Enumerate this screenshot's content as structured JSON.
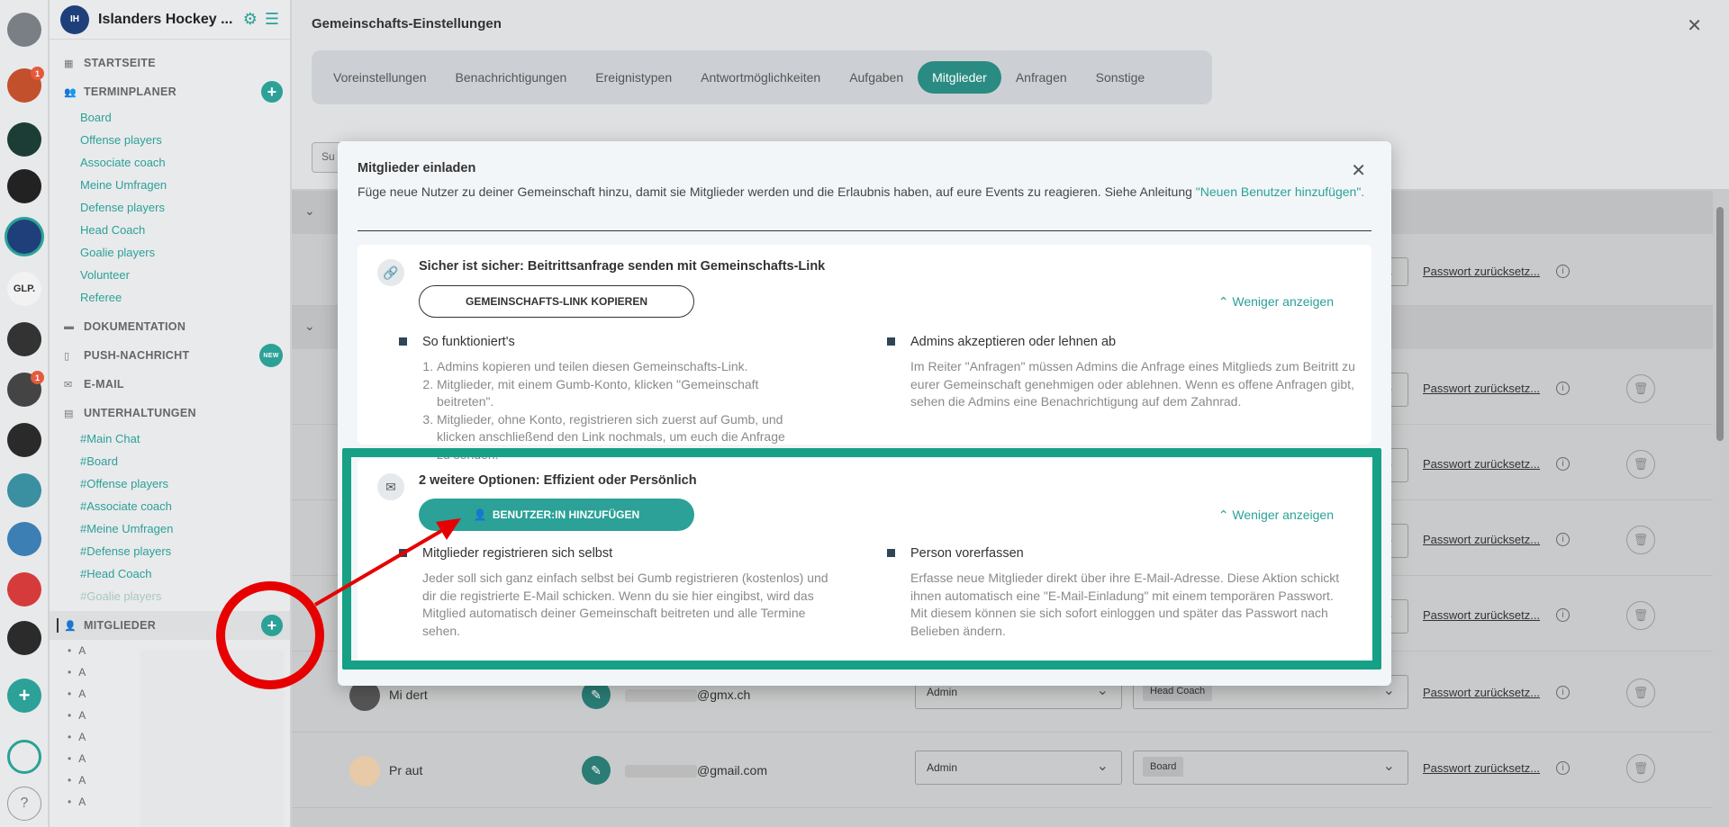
{
  "community": {
    "name": "Islanders Hockey ...",
    "rail": [
      {
        "label": "",
        "color": "#7a7f86",
        "badge": ""
      },
      {
        "label": "",
        "color": "#c2502d",
        "badge": "1"
      },
      {
        "label": "",
        "color": "#1c3d36",
        "badge": ""
      },
      {
        "label": "",
        "color": "#222",
        "badge": ""
      },
      {
        "label": "",
        "color": "#1f3f7a",
        "badge": ""
      },
      {
        "label": "GLP.",
        "color": "#f2f2f2",
        "badge": ""
      },
      {
        "label": "",
        "color": "#333",
        "badge": ""
      },
      {
        "label": "",
        "color": "#444",
        "badge": "1"
      },
      {
        "label": "",
        "color": "#2a2a2a",
        "badge": ""
      },
      {
        "label": "",
        "color": "#3a8fa0",
        "badge": ""
      },
      {
        "label": "",
        "color": "#3b7fb5",
        "badge": ""
      },
      {
        "label": "",
        "color": "#d63b3b",
        "badge": ""
      },
      {
        "label": "",
        "color": "#2b2b2b",
        "badge": ""
      }
    ],
    "add_label": "+",
    "help_label": "?"
  },
  "sidebar": {
    "startseite": "STARTSEITE",
    "terminplaner": "TERMINPLANER",
    "termin_items": [
      "Board",
      "Offense players",
      "Associate coach",
      "Meine Umfragen",
      "Defense players",
      "Head Coach",
      "Goalie players",
      "Volunteer",
      "Referee"
    ],
    "dokumentation": "DOKUMENTATION",
    "push": "PUSH-NACHRICHT",
    "push_badge": "NEW",
    "email": "E-MAIL",
    "unterhaltungen": "UNTERHALTUNGEN",
    "chat_items": [
      "#Main Chat",
      "#Board",
      "#Offense players",
      "#Associate coach",
      "#Meine Umfragen",
      "#Defense players",
      "#Head Coach"
    ],
    "chat_dim": "#Goalie players",
    "mitglieder": "MITGLIEDER",
    "members": [
      "A",
      "A",
      "A",
      "A",
      "A",
      "A",
      "A",
      "A"
    ]
  },
  "main": {
    "title": "Gemeinschafts-Einstellungen",
    "tabs": [
      "Voreinstellungen",
      "Benachrichtigungen",
      "Ereignistypen",
      "Antwortmöglichkeiten",
      "Aufgaben",
      "Mitglieder",
      "Anfragen",
      "Sonstige"
    ],
    "active_tab": "Mitglieder",
    "search_stub": "Su",
    "rows": [
      {
        "name": "Mi      dert",
        "email": "@gmx.ch",
        "role": "Admin",
        "group": "Head Coach",
        "pw": "Passwort zurücksetz..."
      },
      {
        "name": "Pr      aut",
        "email": "@gmail.com",
        "role": "Admin",
        "group": "Board",
        "pw": "Passwort zurücksetz..."
      }
    ],
    "pw_link": "Passwort zurücksetz..."
  },
  "modal": {
    "title": "Mitglieder einladen",
    "desc": "Füge neue Nutzer zu deiner Gemeinschaft hinzu, damit sie Mitglieder werden und die Erlaubnis haben, auf eure Events zu reagieren. Siehe Anleitung ",
    "desc_link": "\"Neuen Benutzer hinzufügen\".",
    "card1": {
      "title": "Sicher ist sicher: Beitrittsanfrage senden mit Gemeinschafts-Link",
      "button": "GEMEINSCHAFTS-LINK KOPIEREN",
      "less": "Weniger anzeigen",
      "left_head": "So funktioniert's",
      "left_steps": [
        "Admins kopieren und teilen diesen Gemeinschafts-Link.",
        "Mitglieder, mit einem Gumb-Konto, klicken \"Gemeinschaft beitreten\".",
        "Mitglieder, ohne Konto, registrieren sich zuerst auf Gumb, und klicken anschließend den Link nochmals, um euch die Anfrage zu senden."
      ],
      "right_head": "Admins akzeptieren oder lehnen ab",
      "right_text": "Im Reiter \"Anfragen\" müssen Admins die Anfrage eines Mitglieds zum Beitritt zu eurer Gemeinschaft genehmigen oder ablehnen. Wenn es offene Anfragen gibt, sehen die Admins eine Benachrichtigung auf dem Zahnrad."
    },
    "card2": {
      "title": "2 weitere Optionen: Effizient oder Persönlich",
      "button": "BENUTZER:IN HINZUFÜGEN",
      "less": "Weniger anzeigen",
      "left_head": "Mitglieder registrieren sich selbst",
      "left_text": "Jeder soll sich ganz einfach selbst bei Gumb registrieren (kostenlos) und dir die registrierte E-Mail schicken. Wenn du sie hier eingibst, wird das Mitglied automatisch deiner Gemeinschaft beitreten und alle Termine sehen.",
      "right_head": "Person vorerfassen",
      "right_text": "Erfasse neue Mitglieder direkt über ihre E-Mail-Adresse. Diese Aktion schickt ihnen automatisch eine \"E-Mail-Einladung\" mit einem temporären Passwort. Mit diesem können sie sich sofort einloggen und später das Passwort nach Belieben ändern."
    }
  },
  "colors": {
    "accent": "#2ba197",
    "highlight": "#16a085",
    "annotation": "#e60000"
  }
}
